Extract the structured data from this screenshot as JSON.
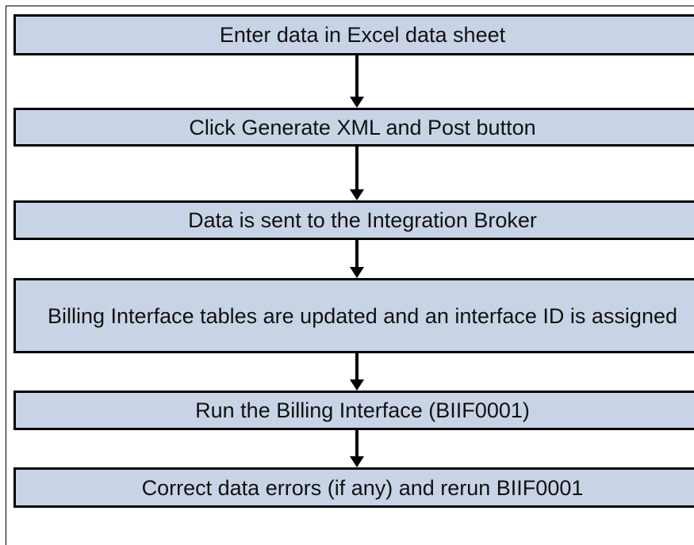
{
  "flowchart": {
    "steps": [
      {
        "label": "Enter data in Excel data sheet"
      },
      {
        "label": "Click Generate XML and Post button"
      },
      {
        "label": "Data is sent to the Integration Broker"
      },
      {
        "label": "Billing Interface tables are updated and an interface ID is assigned"
      },
      {
        "label": "Run the Billing Interface (BIIF0001)"
      },
      {
        "label": "Correct data errors (if any) and rerun BIIF0001"
      }
    ],
    "colors": {
      "box_fill": "#c8d4e6",
      "box_border": "#000000",
      "arrow": "#000000"
    }
  }
}
